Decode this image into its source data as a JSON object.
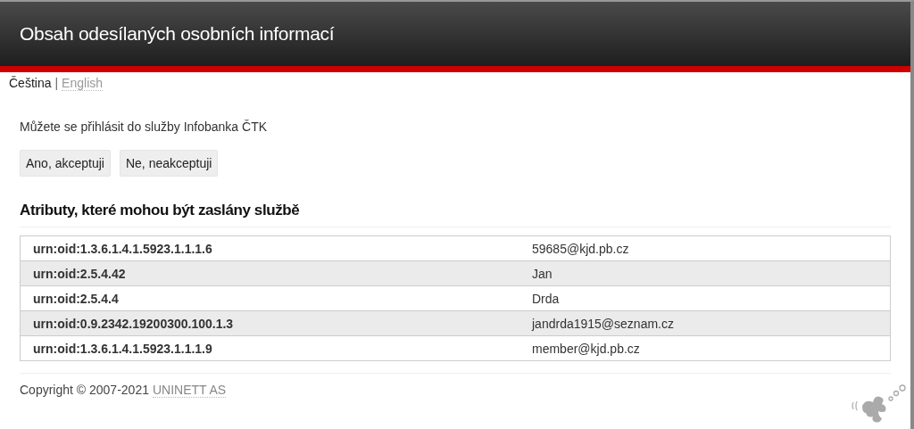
{
  "header": {
    "title": "Obsah odesílaných osobních informací"
  },
  "languages": [
    {
      "label": "Čeština",
      "selected": true
    },
    {
      "label": "English",
      "selected": false
    }
  ],
  "language_separator": "|",
  "intro": "Můžete se přihlásit do služby Infobanka ČTK",
  "buttons": [
    "Ano, akceptuji",
    "Ne, neakceptuji"
  ],
  "attributes_heading": "Atributy, které mohou být zaslány službě",
  "attributes": [
    {
      "name": "urn:oid:1.3.6.1.4.1.5923.1.1.1.6",
      "value": "59685@kjd.pb.cz"
    },
    {
      "name": "urn:oid:2.5.4.42",
      "value": "Jan"
    },
    {
      "name": "urn:oid:2.5.4.4",
      "value": "Drda"
    },
    {
      "name": "urn:oid:0.9.2342.19200300.100.1.3",
      "value": "jandrda1915@seznam.cz"
    },
    {
      "name": "urn:oid:1.3.6.1.4.1.5923.1.1.1.9",
      "value": "member@kjd.pb.cz"
    }
  ],
  "footer": {
    "copyright": "Copyright © 2007-2021",
    "link": "UNINETT AS"
  }
}
